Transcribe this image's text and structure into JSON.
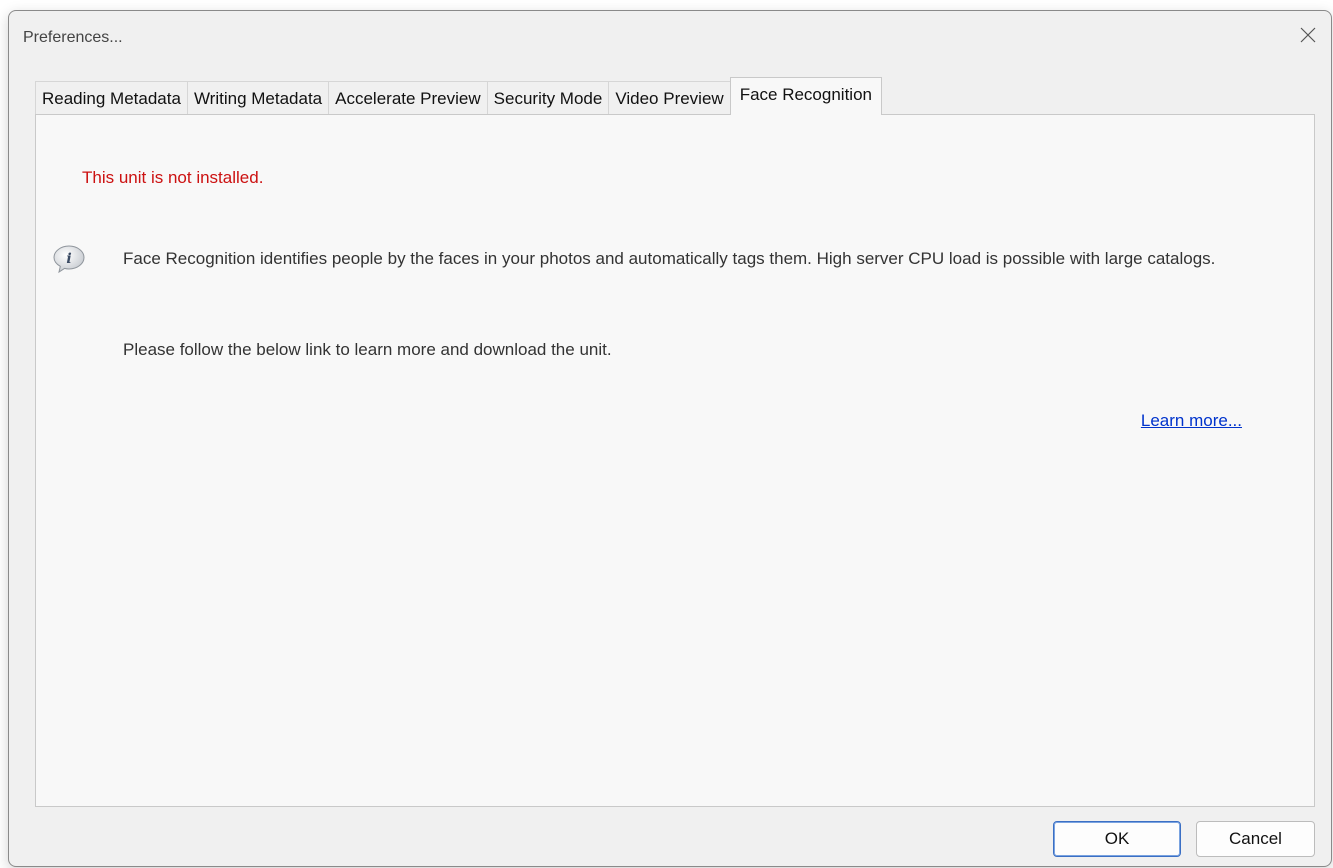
{
  "window": {
    "title": "Preferences..."
  },
  "tabs": [
    {
      "label": "Reading Metadata",
      "active": false
    },
    {
      "label": "Writing Metadata",
      "active": false
    },
    {
      "label": "Accelerate Preview",
      "active": false
    },
    {
      "label": "Security Mode",
      "active": false
    },
    {
      "label": "Video Preview",
      "active": false
    },
    {
      "label": "Face Recognition",
      "active": true
    }
  ],
  "panel": {
    "error_message": "This unit is not installed.",
    "info_text": "Face Recognition identifies people by the faces in your photos and automatically tags them. High server CPU load is possible with large catalogs.",
    "follow_text": "Please follow the below link to learn more and download the unit.",
    "learn_more_link": "Learn more..."
  },
  "buttons": {
    "ok_label": "OK",
    "cancel_label": "Cancel"
  },
  "colors": {
    "error": "#cc1111",
    "link": "#0033cc",
    "ok_border": "#3b6fc4"
  },
  "icons": {
    "close": "close-icon",
    "info": "info-icon"
  }
}
